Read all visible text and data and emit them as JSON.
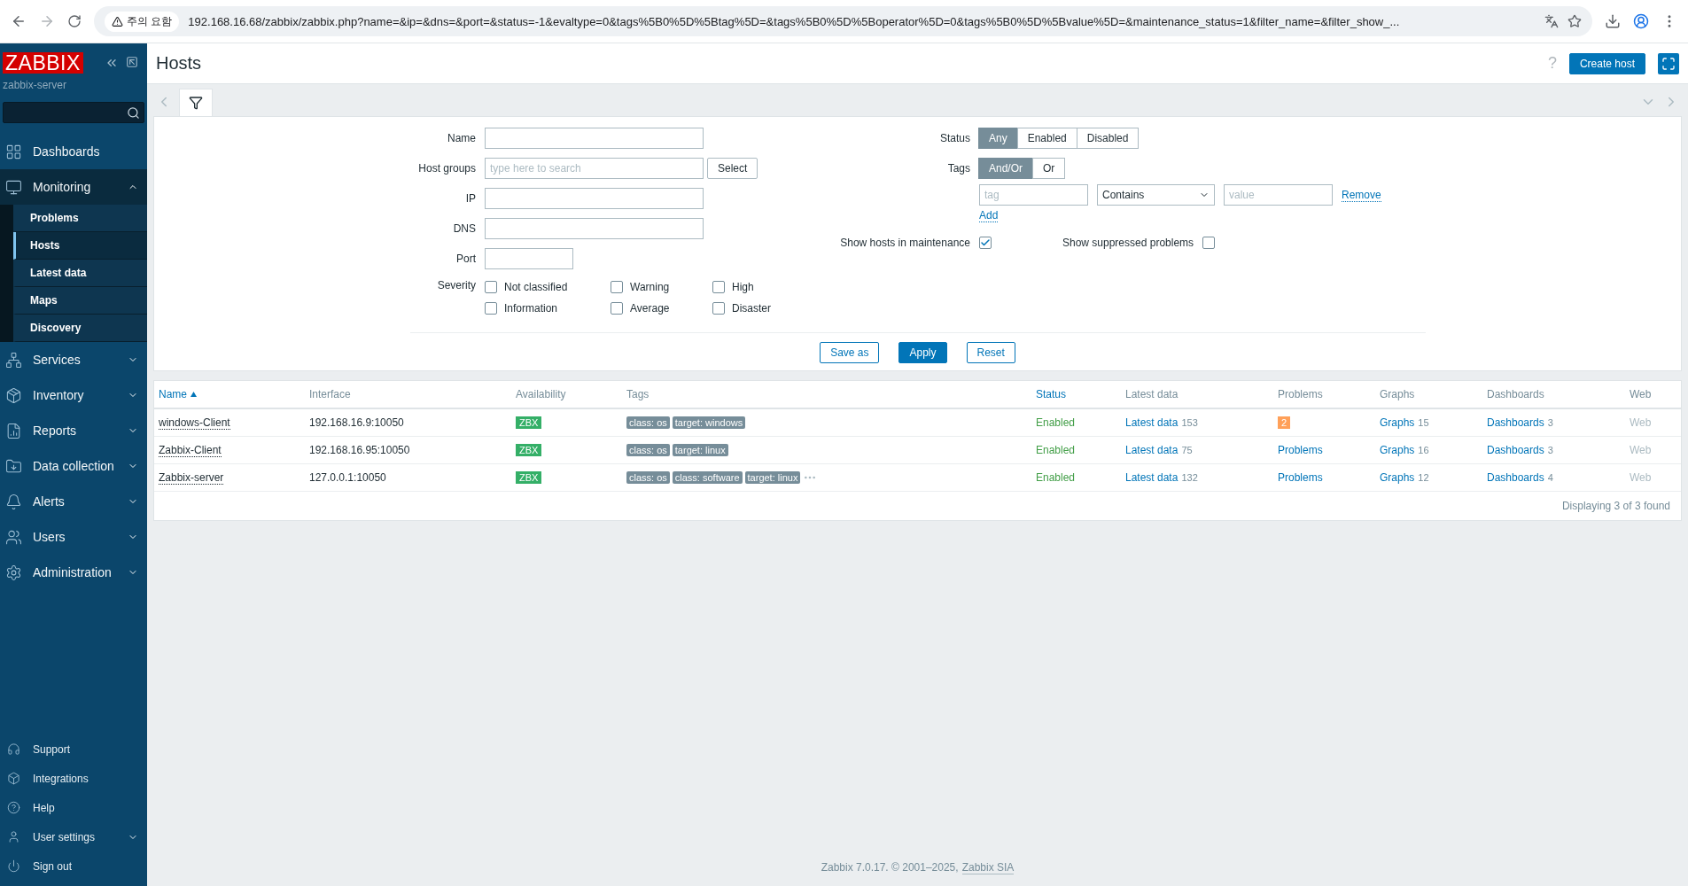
{
  "browser": {
    "warning": "주의 요함",
    "url": "192.168.16.68/zabbix/zabbix.php?name=&ip=&dns=&port=&status=-1&evaltype=0&tags%5B0%5D%5Btag%5D=&tags%5B0%5D%5Boperator%5D=0&tags%5B0%5D%5Bvalue%5D=&maintenance_status=1&filter_name=&filter_show_..."
  },
  "sidebar": {
    "logo": "ZABBIX",
    "server": "zabbix-server",
    "menu": [
      {
        "label": "Dashboards",
        "kind": "link"
      },
      {
        "label": "Monitoring",
        "kind": "group",
        "expanded": true,
        "children": [
          {
            "label": "Problems",
            "selected": false
          },
          {
            "label": "Hosts",
            "selected": true
          },
          {
            "label": "Latest data",
            "selected": false
          },
          {
            "label": "Maps",
            "selected": false
          },
          {
            "label": "Discovery",
            "selected": false
          }
        ]
      },
      {
        "label": "Services",
        "kind": "group",
        "expanded": false
      },
      {
        "label": "Inventory",
        "kind": "group",
        "expanded": false
      },
      {
        "label": "Reports",
        "kind": "group",
        "expanded": false
      },
      {
        "label": "Data collection",
        "kind": "group",
        "expanded": false
      },
      {
        "label": "Alerts",
        "kind": "group",
        "expanded": false
      },
      {
        "label": "Users",
        "kind": "group",
        "expanded": false
      },
      {
        "label": "Administration",
        "kind": "group",
        "expanded": false
      }
    ],
    "bottom": [
      {
        "label": "Support",
        "kind": "link"
      },
      {
        "label": "Integrations",
        "kind": "link"
      },
      {
        "label": "Help",
        "kind": "link"
      },
      {
        "label": "User settings",
        "kind": "group",
        "expanded": false
      },
      {
        "label": "Sign out",
        "kind": "link"
      }
    ]
  },
  "header": {
    "title": "Hosts",
    "help": "?",
    "button": "Create host"
  },
  "filter": {
    "name": {
      "label": "Name"
    },
    "host_groups": {
      "label": "Host groups",
      "placeholder": "type here to search",
      "button": "Select"
    },
    "ip": {
      "label": "IP"
    },
    "dns": {
      "label": "DNS"
    },
    "port": {
      "label": "Port"
    },
    "severity": {
      "label": "Severity",
      "options": [
        {
          "label": "Not classified",
          "checked": false
        },
        {
          "label": "Warning",
          "checked": false
        },
        {
          "label": "High",
          "checked": false
        },
        {
          "label": "Information",
          "checked": false
        },
        {
          "label": "Average",
          "checked": false
        },
        {
          "label": "Disaster",
          "checked": false
        }
      ]
    },
    "status": {
      "label": "Status",
      "options": [
        {
          "label": "Any",
          "selected": true
        },
        {
          "label": "Enabled",
          "selected": false
        },
        {
          "label": "Disabled",
          "selected": false
        }
      ]
    },
    "tags": {
      "label": "Tags",
      "options": [
        {
          "label": "And/Or",
          "selected": true
        },
        {
          "label": "Or",
          "selected": false
        }
      ],
      "tag_placeholder": "tag",
      "operator": "Contains",
      "value_placeholder": "value",
      "remove": "Remove",
      "add": "Add"
    },
    "maintenance": {
      "label": "Show hosts in maintenance",
      "checked": true
    },
    "suppressed": {
      "label": "Show suppressed problems",
      "checked": false
    },
    "buttons": [
      {
        "label": "Save as",
        "kind": "secondary"
      },
      {
        "label": "Apply",
        "kind": "primary"
      },
      {
        "label": "Reset",
        "kind": "secondary"
      }
    ]
  },
  "table": {
    "columns": [
      {
        "label": "Name",
        "sortable": true,
        "sorted": true
      },
      {
        "label": "Interface",
        "sortable": false,
        "sorted": false
      },
      {
        "label": "Availability",
        "sortable": false,
        "sorted": false
      },
      {
        "label": "Tags",
        "sortable": false,
        "sorted": false
      },
      {
        "label": "Status",
        "sortable": true,
        "sorted": false
      },
      {
        "label": "Latest data",
        "sortable": false,
        "sorted": false
      },
      {
        "label": "Problems",
        "sortable": false,
        "sorted": false
      },
      {
        "label": "Graphs",
        "sortable": false,
        "sorted": false
      },
      {
        "label": "Dashboards",
        "sortable": false,
        "sorted": false
      },
      {
        "label": "Web",
        "sortable": false,
        "sorted": false
      }
    ],
    "rows": [
      {
        "name": "windows-Client",
        "interface": "192.168.16.9:10050",
        "availability": "ZBX",
        "tags": [
          "class: os",
          "target: windows"
        ],
        "more_tags": false,
        "status": "Enabled",
        "latest_data": {
          "label": "Latest data",
          "count": "153"
        },
        "problems": {
          "kind": "count",
          "text": "2"
        },
        "graphs": {
          "label": "Graphs",
          "count": "15"
        },
        "dashboards": {
          "label": "Dashboards",
          "count": "3"
        },
        "web": "Web"
      },
      {
        "name": "Zabbix-Client",
        "interface": "192.168.16.95:10050",
        "availability": "ZBX",
        "tags": [
          "class: os",
          "target: linux"
        ],
        "more_tags": false,
        "status": "Enabled",
        "latest_data": {
          "label": "Latest data",
          "count": "75"
        },
        "problems": {
          "kind": "link",
          "text": "Problems"
        },
        "graphs": {
          "label": "Graphs",
          "count": "16"
        },
        "dashboards": {
          "label": "Dashboards",
          "count": "3"
        },
        "web": "Web"
      },
      {
        "name": "Zabbix-server",
        "interface": "127.0.0.1:10050",
        "availability": "ZBX",
        "tags": [
          "class: os",
          "class: software",
          "target: linux"
        ],
        "more_tags": true,
        "status": "Enabled",
        "latest_data": {
          "label": "Latest data",
          "count": "132"
        },
        "problems": {
          "kind": "link",
          "text": "Problems"
        },
        "graphs": {
          "label": "Graphs",
          "count": "12"
        },
        "dashboards": {
          "label": "Dashboards",
          "count": "4"
        },
        "web": "Web"
      }
    ],
    "summary": "Displaying 3 of 3 found"
  },
  "footer": {
    "text": "Zabbix 7.0.17. © 2001–2025,",
    "link": "Zabbix SIA"
  }
}
